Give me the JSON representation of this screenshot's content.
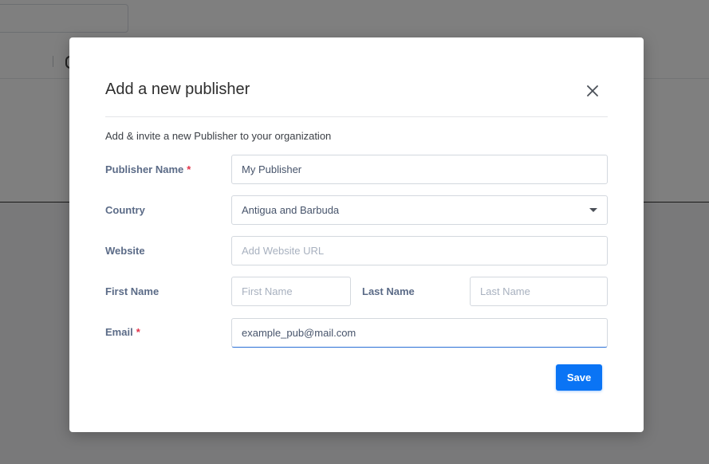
{
  "modal": {
    "title": "Add a new publisher",
    "subtitle": "Add & invite a new Publisher to your organization",
    "close_icon": "close-icon",
    "required_marker": "*"
  },
  "form": {
    "publisher_name": {
      "label": "Publisher Name",
      "value": "My Publisher",
      "placeholder": "",
      "required": true
    },
    "country": {
      "label": "Country",
      "selected": "Antigua and Barbuda",
      "icon": "chevron-down-icon"
    },
    "website": {
      "label": "Website",
      "value": "",
      "placeholder": "Add Website URL"
    },
    "first_name": {
      "label": "First Name",
      "value": "",
      "placeholder": "First Name"
    },
    "last_name": {
      "label": "Last Name",
      "value": "",
      "placeholder": "Last Name"
    },
    "email": {
      "label": "Email",
      "value": "example_pub@mail.com",
      "placeholder": "",
      "required": true
    },
    "save_label": "Save"
  },
  "colors": {
    "accent": "#0a74f5",
    "required": "#e2334a",
    "label": "#5b6b87",
    "focus_underline": "#2a6fd6"
  }
}
